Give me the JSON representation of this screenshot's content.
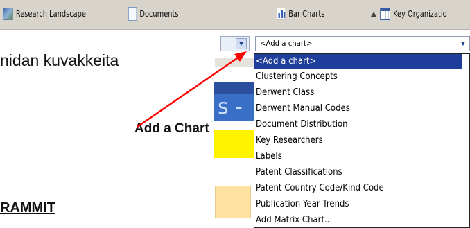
{
  "toolbar": {
    "items": [
      {
        "label": "Research Landscape",
        "icon": "landscape-icon"
      },
      {
        "label": "Documents",
        "icon": "document-icon"
      },
      {
        "label": "Bar Charts",
        "icon": "bar-chart-icon"
      },
      {
        "label": "Key Organizatio",
        "icon": "grid-icon"
      }
    ]
  },
  "slide": {
    "text_line": "nidan kuvakkeita",
    "callout_label": "Add a Chart",
    "heading": "RAMMIT"
  },
  "background": {
    "blue_text": "s -"
  },
  "combo": {
    "value": "<Add a chart>"
  },
  "dropdown": {
    "options": [
      "<Add a chart>",
      "Clustering Concepts",
      "Derwent Class",
      "Derwent Manual Codes",
      "Document Distribution",
      "Key Researchers",
      "Labels",
      "Patent Classifications",
      "Patent Country Code/Kind Code",
      "Publication Year Trends",
      "Add Matrix Chart..."
    ],
    "selected_index": 0
  },
  "colors": {
    "selection": "#1f3e9c",
    "annotation_arrow": "#ff0000",
    "toolbar_bg": "#d8d4cc"
  }
}
